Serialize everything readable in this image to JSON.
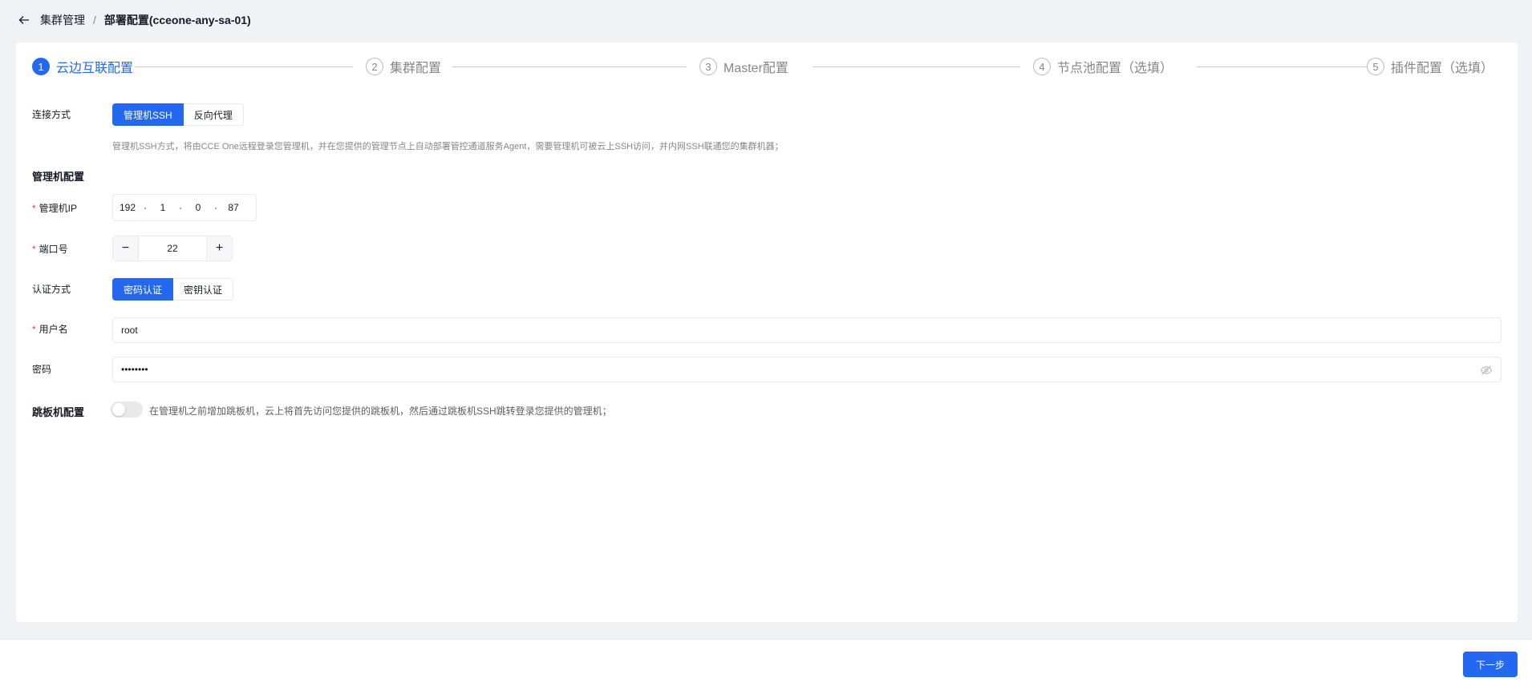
{
  "breadcrumb": {
    "parent": "集群管理",
    "separator": "/",
    "current": "部署配置(cceone-any-sa-01)"
  },
  "steps": [
    {
      "number": "1",
      "label": "云边互联配置",
      "active": true
    },
    {
      "number": "2",
      "label": "集群配置",
      "active": false
    },
    {
      "number": "3",
      "label": "Master配置",
      "active": false
    },
    {
      "number": "4",
      "label": "节点池配置（选填）",
      "active": false
    },
    {
      "number": "5",
      "label": "插件配置（选填）",
      "active": false
    }
  ],
  "connection": {
    "label": "连接方式",
    "options": [
      "管理机SSH",
      "反向代理"
    ],
    "selected": "管理机SSH",
    "description": "管理机SSH方式，将由CCE One远程登录您管理机，并在您提供的管理节点上自动部署管控通道服务Agent，需要管理机可被云上SSH访问，并内网SSH联通您的集群机器；"
  },
  "manager_section": {
    "title": "管理机配置"
  },
  "ip": {
    "required_mark": "*",
    "label": "管理机IP",
    "segments": [
      "192",
      "1",
      "0",
      "87"
    ],
    "dot": "·"
  },
  "port": {
    "required_mark": "*",
    "label": "端口号",
    "value": "22",
    "minus": "−",
    "plus": "+"
  },
  "auth": {
    "label": "认证方式",
    "options": [
      "密码认证",
      "密钥认证"
    ],
    "selected": "密码认证"
  },
  "username": {
    "required_mark": "*",
    "label": "用户名",
    "value": "root"
  },
  "password": {
    "label": "密码",
    "value": "••••••••",
    "icon": "eye-off-icon"
  },
  "jump_host": {
    "title": "跳板机配置",
    "enabled": false,
    "description": "在管理机之前增加跳板机，云上将首先访问您提供的跳板机，然后通过跳板机SSH跳转登录您提供的管理机；"
  },
  "footer": {
    "next_label": "下一步"
  },
  "colors": {
    "accent": "#2468f2",
    "required": "#f33e3e",
    "background": "#f0f2f5"
  }
}
